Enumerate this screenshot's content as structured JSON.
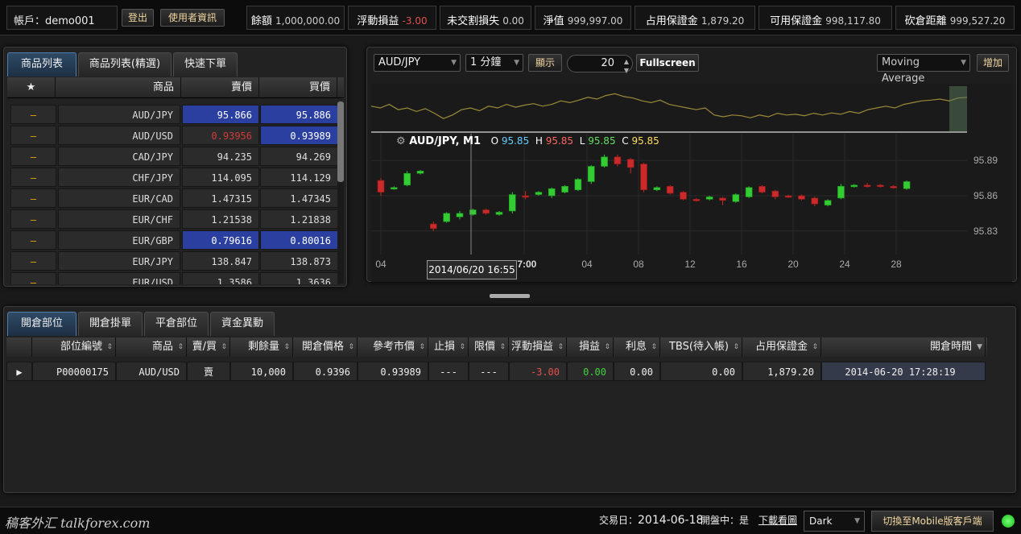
{
  "topbar": {
    "account_label": "帳戶：",
    "account_value": "demo001",
    "logout": "登出",
    "user_info": "使用者資訊",
    "stats": [
      {
        "label": "餘額",
        "value": "1,000,000.00"
      },
      {
        "label": "浮動損益",
        "value": "-3.00"
      },
      {
        "label": "未交割損失",
        "value": "0.00"
      },
      {
        "label": "淨值",
        "value": "999,997.00"
      },
      {
        "label": "占用保證金",
        "value": "1,879.20"
      },
      {
        "label": "可用保證金",
        "value": "998,117.80"
      },
      {
        "label": "砍倉距離",
        "value": "999,527.20"
      }
    ]
  },
  "products": {
    "tabs": [
      "商品列表",
      "商品列表(精選)",
      "快速下單"
    ],
    "headers": {
      "star": "★",
      "product": "商品",
      "sell": "賣價",
      "buy": "買價"
    },
    "rows": [
      {
        "star": "–",
        "symbol": "AUD/JPY",
        "sell": "95.866",
        "buy": "95.886"
      },
      {
        "star": "–",
        "symbol": "AUD/USD",
        "sell": "0.93956",
        "buy": "0.93989"
      },
      {
        "star": "–",
        "symbol": "CAD/JPY",
        "sell": "94.235",
        "buy": "94.269"
      },
      {
        "star": "–",
        "symbol": "CHF/JPY",
        "sell": "114.095",
        "buy": "114.129"
      },
      {
        "star": "–",
        "symbol": "EUR/CAD",
        "sell": "1.47315",
        "buy": "1.47345"
      },
      {
        "star": "–",
        "symbol": "EUR/CHF",
        "sell": "1.21538",
        "buy": "1.21838"
      },
      {
        "star": "–",
        "symbol": "EUR/GBP",
        "sell": "0.79616",
        "buy": "0.80016"
      },
      {
        "star": "–",
        "symbol": "EUR/JPY",
        "sell": "138.847",
        "buy": "138.873"
      },
      {
        "star": "–",
        "symbol": "EUR/USD",
        "sell": "1.3586",
        "buy": "1.3636"
      }
    ]
  },
  "chart_toolbar": {
    "symbol": "AUD/JPY",
    "interval": "1 分鐘",
    "show_btn": "顯示",
    "count": "20",
    "fullscreen": "Fullscreen",
    "indicator": "Moving Average",
    "add_btn": "增加"
  },
  "chart_data": {
    "type": "candlestick",
    "title": "AUD/JPY, M1",
    "ohlc_label": {
      "o": "O",
      "o_val": "95.85",
      "h": "H",
      "h_val": "95.85",
      "l": "L",
      "l_val": "95.85",
      "c": "C",
      "c_val": "95.85"
    },
    "y_ticks": [
      "95.89",
      "95.86",
      "95.83"
    ],
    "x_ticks": [
      "04",
      "17:00",
      "04",
      "08",
      "12",
      "16",
      "20",
      "24",
      "28"
    ],
    "crosshair_label": "2014/06/20 16:55",
    "ylim": [
      95.81,
      95.91
    ],
    "candles": [
      {
        "o": 95.873,
        "c": 95.863,
        "h": 95.875,
        "l": 95.86
      },
      {
        "o": 95.866,
        "c": 95.867,
        "h": 95.868,
        "l": 95.865
      },
      {
        "o": 95.869,
        "c": 95.879,
        "h": 95.881,
        "l": 95.868
      },
      {
        "o": 95.879,
        "c": 95.881,
        "h": 95.882,
        "l": 95.878
      },
      {
        "o": 95.836,
        "c": 95.832,
        "h": 95.838,
        "l": 95.83
      },
      {
        "o": 95.838,
        "c": 95.845,
        "h": 95.846,
        "l": 95.837
      },
      {
        "o": 95.842,
        "c": 95.845,
        "h": 95.847,
        "l": 95.84
      },
      {
        "o": 95.844,
        "c": 95.848,
        "h": 95.849,
        "l": 95.843
      },
      {
        "o": 95.848,
        "c": 95.845,
        "h": 95.849,
        "l": 95.844
      },
      {
        "o": 95.844,
        "c": 95.846,
        "h": 95.847,
        "l": 95.843
      },
      {
        "o": 95.847,
        "c": 95.861,
        "h": 95.863,
        "l": 95.845
      },
      {
        "o": 95.86,
        "c": 95.859,
        "h": 95.864,
        "l": 95.857
      },
      {
        "o": 95.861,
        "c": 95.863,
        "h": 95.864,
        "l": 95.86
      },
      {
        "o": 95.86,
        "c": 95.866,
        "h": 95.867,
        "l": 95.858
      },
      {
        "o": 95.863,
        "c": 95.868,
        "h": 95.869,
        "l": 95.862
      },
      {
        "o": 95.865,
        "c": 95.874,
        "h": 95.875,
        "l": 95.864
      },
      {
        "o": 95.872,
        "c": 95.885,
        "h": 95.886,
        "l": 95.87
      },
      {
        "o": 95.885,
        "c": 95.893,
        "h": 95.895,
        "l": 95.884
      },
      {
        "o": 95.893,
        "c": 95.887,
        "h": 95.895,
        "l": 95.885
      },
      {
        "o": 95.891,
        "c": 95.884,
        "h": 95.892,
        "l": 95.879
      },
      {
        "o": 95.887,
        "c": 95.865,
        "h": 95.888,
        "l": 95.863
      },
      {
        "o": 95.865,
        "c": 95.867,
        "h": 95.868,
        "l": 95.864
      },
      {
        "o": 95.868,
        "c": 95.862,
        "h": 95.869,
        "l": 95.861
      },
      {
        "o": 95.863,
        "c": 95.857,
        "h": 95.864,
        "l": 95.856
      },
      {
        "o": 95.857,
        "c": 95.856,
        "h": 95.858,
        "l": 95.855
      },
      {
        "o": 95.857,
        "c": 95.859,
        "h": 95.86,
        "l": 95.856
      },
      {
        "o": 95.858,
        "c": 95.856,
        "h": 95.859,
        "l": 95.852
      },
      {
        "o": 95.855,
        "c": 95.861,
        "h": 95.862,
        "l": 95.854
      },
      {
        "o": 95.859,
        "c": 95.867,
        "h": 95.868,
        "l": 95.858
      },
      {
        "o": 95.868,
        "c": 95.863,
        "h": 95.869,
        "l": 95.862
      },
      {
        "o": 95.864,
        "c": 95.859,
        "h": 95.865,
        "l": 95.857
      },
      {
        "o": 95.86,
        "c": 95.859,
        "h": 95.861,
        "l": 95.858
      },
      {
        "o": 95.86,
        "c": 95.857,
        "h": 95.861,
        "l": 95.856
      },
      {
        "o": 95.858,
        "c": 95.853,
        "h": 95.859,
        "l": 95.851
      },
      {
        "o": 95.852,
        "c": 95.856,
        "h": 95.857,
        "l": 95.851
      },
      {
        "o": 95.858,
        "c": 95.868,
        "h": 95.87,
        "l": 95.857
      },
      {
        "o": 95.868,
        "c": 95.869,
        "h": 95.87,
        "l": 95.867
      },
      {
        "o": 95.869,
        "c": 95.868,
        "h": 95.871,
        "l": 95.867
      },
      {
        "o": 95.869,
        "c": 95.868,
        "h": 95.87,
        "l": 95.867
      },
      {
        "o": 95.868,
        "c": 95.867,
        "h": 95.869,
        "l": 95.866
      },
      {
        "o": 95.866,
        "c": 95.872,
        "h": 95.873,
        "l": 95.865
      }
    ],
    "overview_series": [
      0.55,
      0.5,
      0.6,
      0.45,
      0.5,
      0.4,
      0.48,
      0.35,
      0.2,
      0.3,
      0.45,
      0.5,
      0.42,
      0.55,
      0.5,
      0.6,
      0.52,
      0.58,
      0.62,
      0.55,
      0.6,
      0.7,
      0.65,
      0.72,
      0.8,
      0.75,
      0.85,
      0.9,
      0.82,
      0.78,
      0.7,
      0.65,
      0.72,
      0.6,
      0.55,
      0.5,
      0.45,
      0.5,
      0.3,
      0.25,
      0.3,
      0.28,
      0.22,
      0.3,
      0.25,
      0.35,
      0.3,
      0.32,
      0.28,
      0.35,
      0.3,
      0.36,
      0.32,
      0.4,
      0.35,
      0.45,
      0.5,
      0.55,
      0.5,
      0.6,
      0.65,
      0.7,
      0.72,
      0.75,
      0.7,
      0.78,
      0.8
    ]
  },
  "positions": {
    "tabs": [
      "開倉部位",
      "開倉掛單",
      "平倉部位",
      "資金異動"
    ],
    "headers": [
      "部位編號",
      "商品",
      "賣/買",
      "剩餘量",
      "開倉價格",
      "參考市價",
      "止損",
      "限價",
      "浮動損益",
      "損益",
      "利息",
      "TBS(待入帳)",
      "占用保證金",
      "開倉時間"
    ],
    "rows": [
      {
        "expand": "▶",
        "id": "P00000175",
        "symbol": "AUD/USD",
        "side": "賣",
        "qty": "10,000",
        "open_price": "0.9396",
        "market": "0.93989",
        "stop": "---",
        "limit": "---",
        "float_pl": "-3.00",
        "pl": "0.00",
        "interest": "0.00",
        "tbs": "0.00",
        "margin": "1,879.20",
        "time": "2014-06-20 17:28:19"
      }
    ]
  },
  "bottombar": {
    "brand": "稿客外汇 talkforex.com",
    "trade_day_label": "交易日：",
    "trade_day": "2014-06-18",
    "market_open_label": "開盤中：",
    "market_open": "是",
    "download": "下載看圖",
    "theme": "Dark",
    "mobile": "切換至Mobile版客戶端"
  },
  "colors": {
    "accent": "#2a3fa0",
    "up": "#33cc33",
    "down": "#cc2a2a",
    "status": "#22dd22"
  }
}
